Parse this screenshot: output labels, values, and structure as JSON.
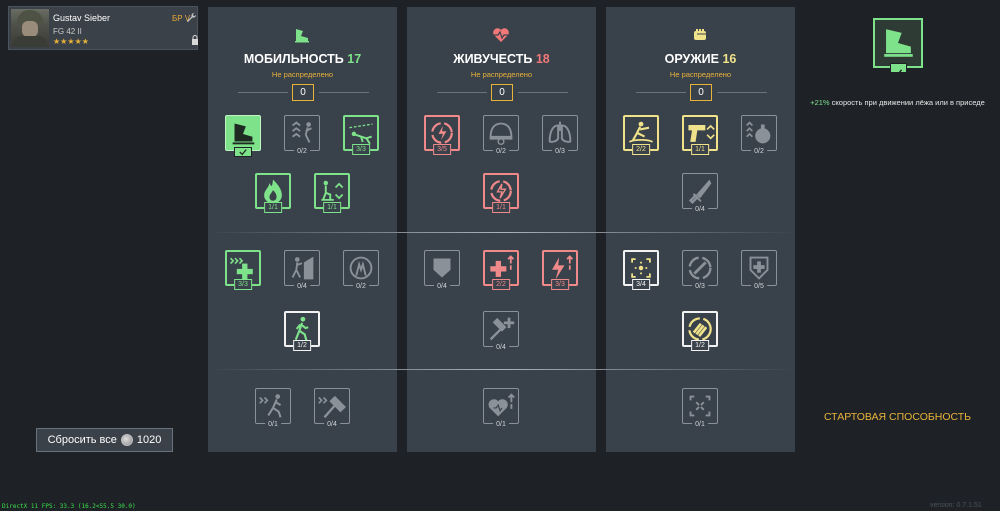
{
  "soldier": {
    "name": "Gustav Sieber",
    "rank": "БР V",
    "weapon": "FG 42 II",
    "stars": "★★★★★"
  },
  "reset": {
    "label": "Сбросить все",
    "cost": "1020"
  },
  "columns": [
    {
      "title": "МОБИЛЬНОСТЬ",
      "value": "17",
      "subtitle": "Не распределено",
      "points": "0",
      "accent": "#7ee28a"
    },
    {
      "title": "ЖИВУЧЕСТЬ",
      "value": "18",
      "subtitle": "Не распределено",
      "points": "0",
      "accent": "#f07878"
    },
    {
      "title": "ОРУЖИЕ",
      "value": "16",
      "subtitle": "Не распределено",
      "points": "0",
      "accent": "#f0e28a"
    }
  ],
  "perks": {
    "mobility": [
      "0/2",
      "3/3",
      "1/1",
      "1/1",
      "3/3",
      "0/4",
      "0/2",
      "1/2",
      "0/1",
      "0/4"
    ],
    "vitality": [
      "3/5",
      "0/2",
      "0/3",
      "1/1",
      "0/4",
      "2/2",
      "3/3",
      "0/4",
      "0/1"
    ],
    "weapon": [
      "2/2",
      "1/1",
      "0/2",
      "0/4",
      "3/4",
      "0/3",
      "0/5",
      "1/2",
      "0/1"
    ]
  },
  "detail": {
    "highlight": "+21%",
    "text": " скорость при движении лёжа или в приседе"
  },
  "start_ability": "СТАРТОВАЯ СПОСОБНОСТЬ",
  "footer": {
    "fps": "DirectX 11 FPS: 33.3 (16.2<55.5 30.0)",
    "version": "version: 0.7.1.51"
  }
}
